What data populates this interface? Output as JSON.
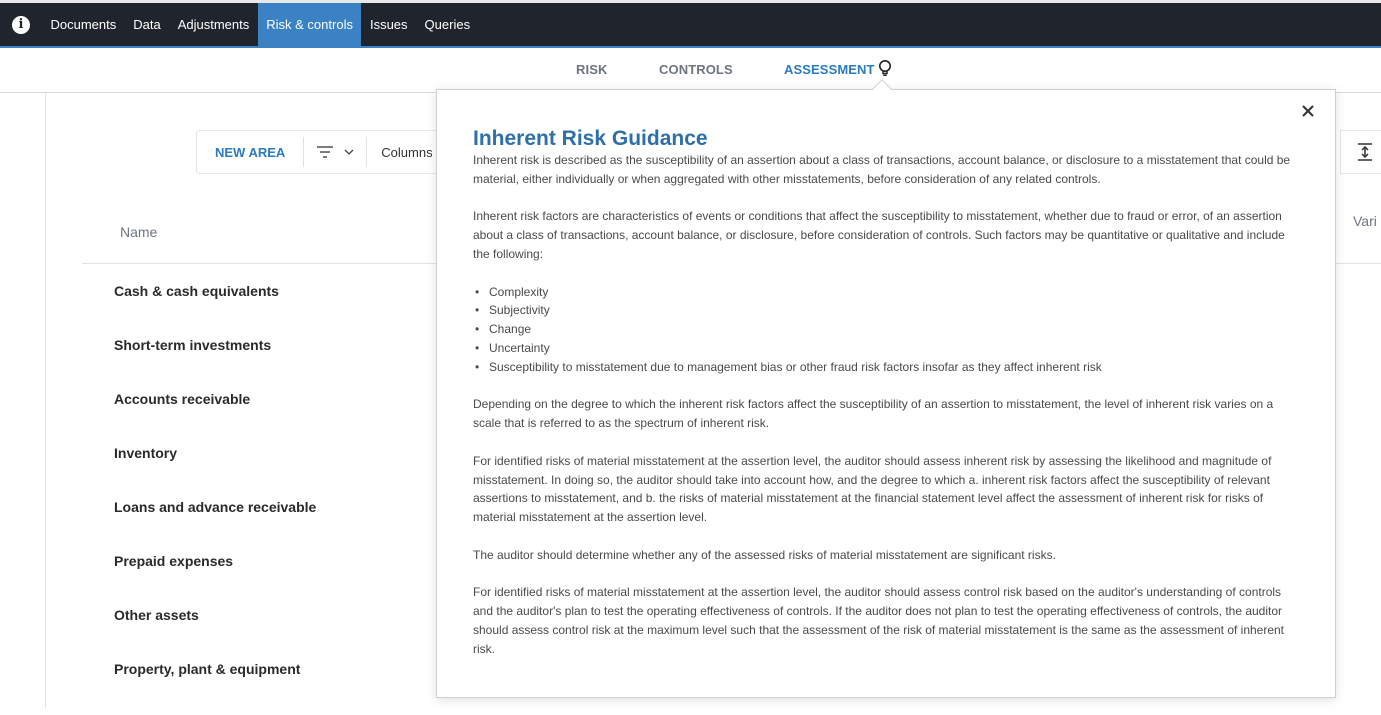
{
  "topnav": {
    "items": [
      {
        "label": "Documents",
        "active": false
      },
      {
        "label": "Data",
        "active": false
      },
      {
        "label": "Adjustments",
        "active": false
      },
      {
        "label": "Risk & controls",
        "active": true
      },
      {
        "label": "Issues",
        "active": false
      },
      {
        "label": "Queries",
        "active": false
      }
    ],
    "colors": {
      "background": "#20242c",
      "active": "#3a82c4"
    }
  },
  "subtabs": {
    "items": [
      {
        "label": "RISK",
        "active": false
      },
      {
        "label": "CONTROLS",
        "active": false
      },
      {
        "label": "ASSESSMENT",
        "active": true
      }
    ],
    "active_color": "#2b7bbf"
  },
  "toolbar": {
    "new_area_label": "NEW AREA",
    "columns_label": "Columns"
  },
  "table": {
    "columns": [
      "Name",
      "Vari"
    ],
    "rows": [
      "Cash & cash equivalents",
      "Short-term investments",
      "Accounts receivable",
      "Inventory",
      "Loans and advance receivable",
      "Prepaid expenses",
      "Other assets",
      "Property, plant & equipment"
    ]
  },
  "guidance": {
    "title": "Inherent Risk Guidance",
    "title_color": "#2f6fa8",
    "paragraphs": [
      "Inherent risk is described as the susceptibility of an assertion about a class of transactions, account balance, or disclosure to a misstatement that could be material, either individually or when aggregated with other misstatements, before consideration of any related controls.",
      "Inherent risk factors are characteristics of events or conditions that affect the susceptibility to misstatement, whether due to fraud or error, of an assertion about a class of transactions, account balance, or disclosure, before consideration of controls. Such factors may be quantitative or qualitative and include the following:"
    ],
    "factors": [
      "Complexity",
      "Subjectivity",
      "Change",
      "Uncertainty",
      "Susceptibility to misstatement due to management bias or other fraud risk factors insofar as they affect inherent risk"
    ],
    "after": [
      "Depending on the degree to which the inherent risk factors affect the susceptibility of an assertion to misstatement, the level of inherent risk varies on a scale that is referred to as the spectrum of inherent risk.",
      "For identified risks of material misstatement at the assertion level, the auditor should assess inherent risk by assessing the likelihood and magnitude of misstatement. In doing so, the auditor should take into account how, and the degree to which a. inherent risk factors affect the susceptibility of relevant assertions to misstatement, and b. the risks of material misstatement at the financial statement level affect the assessment of inherent risk for risks of material misstatement at the assertion level.",
      "The auditor should determine whether any of the assessed risks of material misstatement are significant risks.",
      "For identified risks of material misstatement at the assertion level, the auditor should assess control risk based on the auditor's understanding of controls and the auditor's plan to test the operating effectiveness of controls. If the auditor does not plan to test the operating effectiveness of controls, the auditor should assess control risk at the maximum level such that the assessment of the risk of material misstatement is the same as the assessment of inherent risk."
    ]
  }
}
